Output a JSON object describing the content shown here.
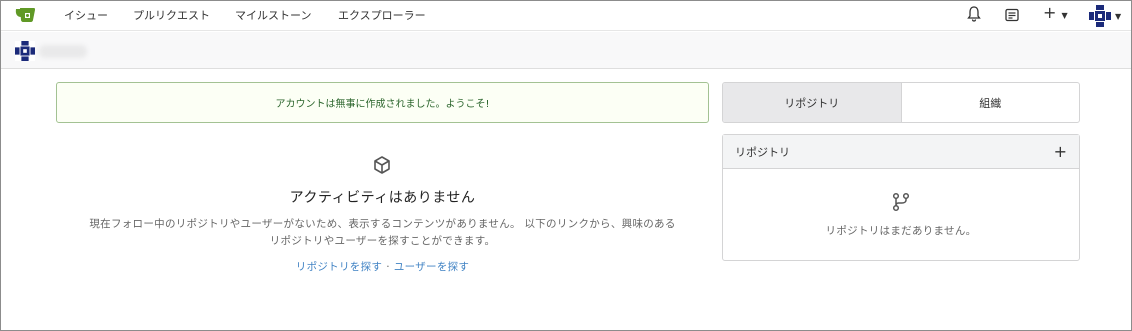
{
  "nav": {
    "items": [
      "イシュー",
      "プルリクエスト",
      "マイルストーン",
      "エクスプローラー"
    ],
    "plus": "+"
  },
  "message": {
    "success": "アカウントは無事に作成されました。ようこそ!"
  },
  "activity": {
    "title": "アクティビティはありません",
    "description_line1": "現在フォロー中のリポジトリやユーザーがないため、表示するコンテンツがありません。 以下のリンクから、興味のある",
    "description_line2": "リポジトリやユーザーを探すことができます。",
    "link_repos": "リポジトリを探す",
    "separator": "·",
    "link_users": "ユーザーを探す"
  },
  "sidebar": {
    "tabs": [
      "リポジトリ",
      "組織"
    ],
    "panel_title": "リポジトリ",
    "panel_add": "+",
    "empty_text": "リポジトリはまだありません。"
  },
  "colors": {
    "success_bg": "#fcfff5",
    "success_border": "#a3c293",
    "success_text": "#2c662d",
    "link": "#4183c4",
    "logo": "#609926"
  }
}
